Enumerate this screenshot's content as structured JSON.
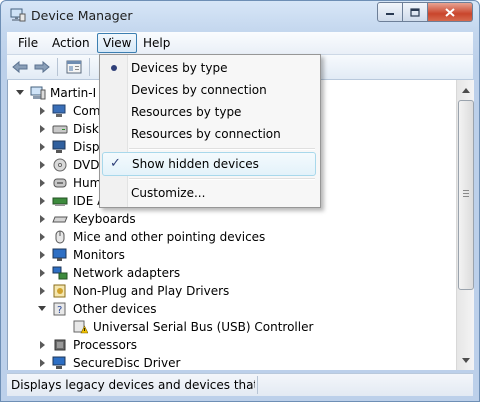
{
  "window": {
    "title": "Device Manager",
    "icon": "device-manager-icon"
  },
  "caption_buttons": {
    "minimize": "minimize",
    "maximize": "maximize",
    "close": "close"
  },
  "menubar": {
    "items": [
      {
        "label": "File"
      },
      {
        "label": "Action"
      },
      {
        "label": "View",
        "active": true
      },
      {
        "label": "Help"
      }
    ]
  },
  "toolbar": {
    "icons": [
      "back-arrow-icon",
      "forward-arrow-icon",
      "properties-icon"
    ]
  },
  "tree": {
    "root": {
      "label": "Martin-I",
      "icon": "computer-icon"
    },
    "items": [
      {
        "label": "Com",
        "icon": "computer-icon"
      },
      {
        "label": "Disk",
        "icon": "disk-drive-icon"
      },
      {
        "label": "Disp",
        "icon": "display-adapter-icon"
      },
      {
        "label": "DVD",
        "icon": "dvd-drive-icon"
      },
      {
        "label": "Hum",
        "icon": "hid-icon"
      },
      {
        "label": "IDE A",
        "icon": "ide-controller-icon"
      },
      {
        "label": "Keyboards",
        "icon": "keyboard-icon"
      },
      {
        "label": "Mice and other pointing devices",
        "icon": "mouse-icon"
      },
      {
        "label": "Monitors",
        "icon": "monitor-icon"
      },
      {
        "label": "Network adapters",
        "icon": "network-adapter-icon"
      },
      {
        "label": "Non-Plug and Play Drivers",
        "icon": "driver-icon"
      },
      {
        "label": "Other devices",
        "icon": "unknown-device-icon",
        "expanded": true
      },
      {
        "label": "Universal Serial Bus (USB) Controller",
        "icon": "warning-device-icon",
        "child": true
      },
      {
        "label": "Processors",
        "icon": "processor-icon"
      },
      {
        "label": "SecureDisc Driver",
        "icon": "securedisc-icon"
      }
    ]
  },
  "view_menu": {
    "items": [
      {
        "label": "Devices by type",
        "mark": "bullet"
      },
      {
        "label": "Devices by connection"
      },
      {
        "label": "Resources by type"
      },
      {
        "label": "Resources by connection"
      },
      {
        "label": "Show hidden devices",
        "mark": "check",
        "highlighted": true
      },
      {
        "label": "Customize..."
      }
    ]
  },
  "statusbar": {
    "text": "Displays legacy devices and devices that are n"
  },
  "colors": {
    "accent": "#3c7fb1",
    "menu_highlight": "#a8d8eb",
    "title_bar": "#c4d7ee",
    "close_button": "#c9452c"
  }
}
